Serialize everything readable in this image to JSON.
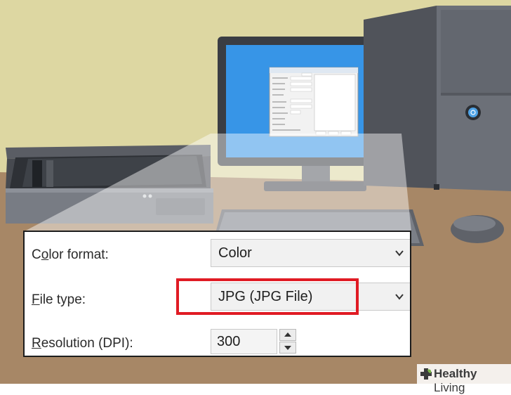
{
  "settings": {
    "color_format": {
      "label_first": "C",
      "label_underline": "o",
      "label_rest": "lor format:",
      "value": "Color"
    },
    "file_type": {
      "label_underline": "F",
      "label_rest": "ile type:",
      "value": "JPG (JPG File)"
    },
    "resolution": {
      "label_underline": "R",
      "label_rest": "esolution (DPI):",
      "value": "300"
    }
  },
  "watermark": {
    "brand": "Healthy",
    "brand_rest": " Living"
  },
  "colors": {
    "highlight": "#e01b24",
    "wall": "#ddd7a2",
    "desk": "#a78766"
  }
}
